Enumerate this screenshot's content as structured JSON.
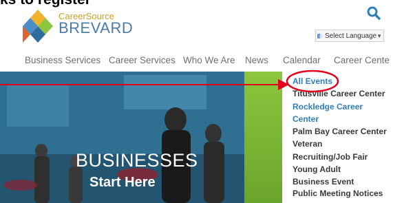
{
  "caption": "ks to register",
  "brand": {
    "small": "CareerSource",
    "big": "BREVARD"
  },
  "colors": {
    "accent": "#2f7fb8",
    "brand_gold": "#c9a227",
    "brand_blue": "#4a7aa8",
    "highlight_green": "#8cc63e",
    "annotation_red": "#e0001b"
  },
  "header": {
    "search_icon": "search-icon",
    "language_label": "Select Language"
  },
  "nav": {
    "items": [
      {
        "label": "Business Services"
      },
      {
        "label": "Career Services"
      },
      {
        "label": "Who We Are"
      },
      {
        "label": "News"
      },
      {
        "label": "Calendar"
      },
      {
        "label": "Career Cente"
      }
    ]
  },
  "hero": {
    "title": "BUSINESSES",
    "subtitle": "Start Here"
  },
  "calendar_menu": {
    "items": [
      {
        "label": "All Events"
      },
      {
        "label": "Titusville Career Center"
      },
      {
        "label": "Rockledge Career"
      },
      {
        "label": "Center"
      },
      {
        "label": "Palm Bay Career Center"
      },
      {
        "label": "Veteran"
      },
      {
        "label": "Recruiting/Job Fair"
      },
      {
        "label": "Young Adult"
      },
      {
        "label": "Business Event"
      },
      {
        "label": "Public Meeting Notices"
      }
    ]
  }
}
